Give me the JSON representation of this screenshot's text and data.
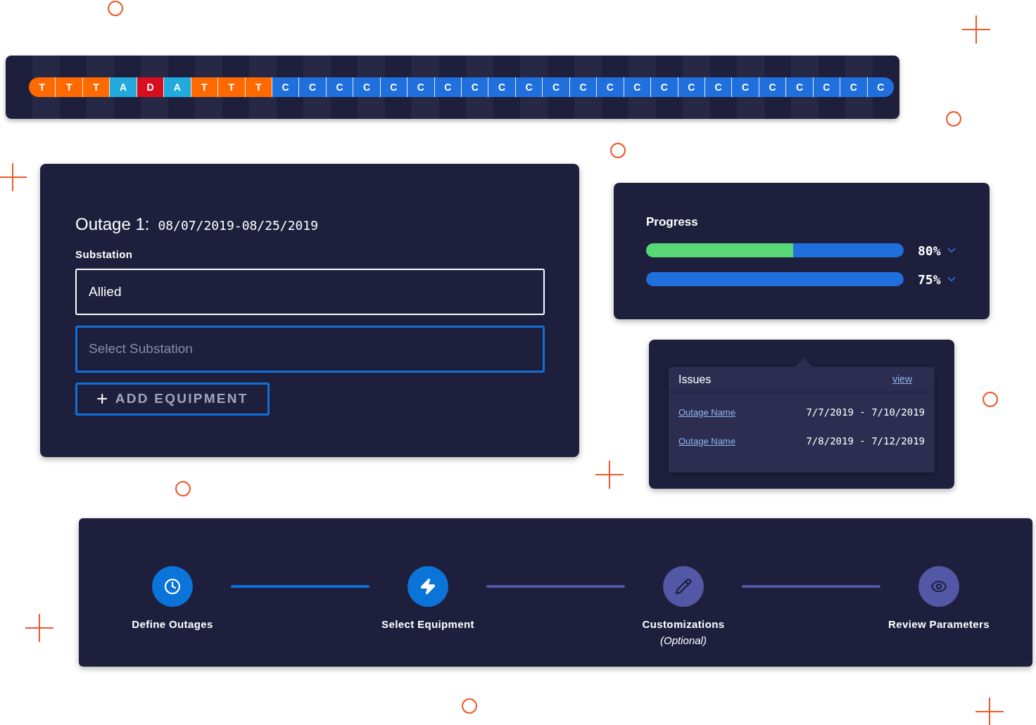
{
  "timeline": {
    "cells": [
      {
        "label": "T",
        "color": "#ff6a00"
      },
      {
        "label": "T",
        "color": "#ff6a00"
      },
      {
        "label": "T",
        "color": "#ff6a00"
      },
      {
        "label": "A",
        "color": "#22aadd"
      },
      {
        "label": "D",
        "color": "#d70d20"
      },
      {
        "label": "A",
        "color": "#22aadd"
      },
      {
        "label": "T",
        "color": "#ff6a00"
      },
      {
        "label": "T",
        "color": "#ff6a00"
      },
      {
        "label": "T",
        "color": "#ff6a00"
      },
      {
        "label": "C",
        "color": "#1f6fdc"
      },
      {
        "label": "C",
        "color": "#1f6fdc"
      },
      {
        "label": "C",
        "color": "#1f6fdc"
      },
      {
        "label": "C",
        "color": "#1f6fdc"
      },
      {
        "label": "C",
        "color": "#1f6fdc"
      },
      {
        "label": "C",
        "color": "#1f6fdc"
      },
      {
        "label": "C",
        "color": "#1f6fdc"
      },
      {
        "label": "C",
        "color": "#1f6fdc"
      },
      {
        "label": "C",
        "color": "#1f6fdc"
      },
      {
        "label": "C",
        "color": "#1f6fdc"
      },
      {
        "label": "C",
        "color": "#1f6fdc"
      },
      {
        "label": "C",
        "color": "#1f6fdc"
      },
      {
        "label": "C",
        "color": "#1f6fdc"
      },
      {
        "label": "C",
        "color": "#1f6fdc"
      },
      {
        "label": "C",
        "color": "#1f6fdc"
      },
      {
        "label": "C",
        "color": "#1f6fdc"
      },
      {
        "label": "C",
        "color": "#1f6fdc"
      },
      {
        "label": "C",
        "color": "#1f6fdc"
      },
      {
        "label": "C",
        "color": "#1f6fdc"
      },
      {
        "label": "C",
        "color": "#1f6fdc"
      },
      {
        "label": "C",
        "color": "#1f6fdc"
      },
      {
        "label": "C",
        "color": "#1f6fdc"
      },
      {
        "label": "C",
        "color": "#1f6fdc"
      }
    ]
  },
  "outage": {
    "title": "Outage 1:",
    "dates": "08/07/2019-08/25/2019",
    "field_label": "Substation",
    "field_value": "Allied",
    "select_placeholder": "Select Substation",
    "add_button": {
      "icon": "+",
      "label": "ADD EQUIPMENT"
    }
  },
  "progress": {
    "title": "Progress",
    "bars": [
      {
        "level": 0.57,
        "reading": "80%"
      },
      {
        "reading": "75%"
      }
    ]
  },
  "issues": {
    "title": "Issues",
    "view_link": "view",
    "rows": [
      {
        "name": "Outage Name",
        "dates": "7/7/2019 - 7/10/2019"
      },
      {
        "name": "Outage Name",
        "dates": "7/8/2019 - 7/12/2019"
      }
    ]
  },
  "stepper": {
    "steps": [
      {
        "label": "Define Outages",
        "done": true
      },
      {
        "label": "Select Equipment",
        "done": true
      },
      {
        "label": "Customizations",
        "note": "(Optional)",
        "done": false
      },
      {
        "label": "Review Parameters",
        "done": false
      }
    ]
  }
}
